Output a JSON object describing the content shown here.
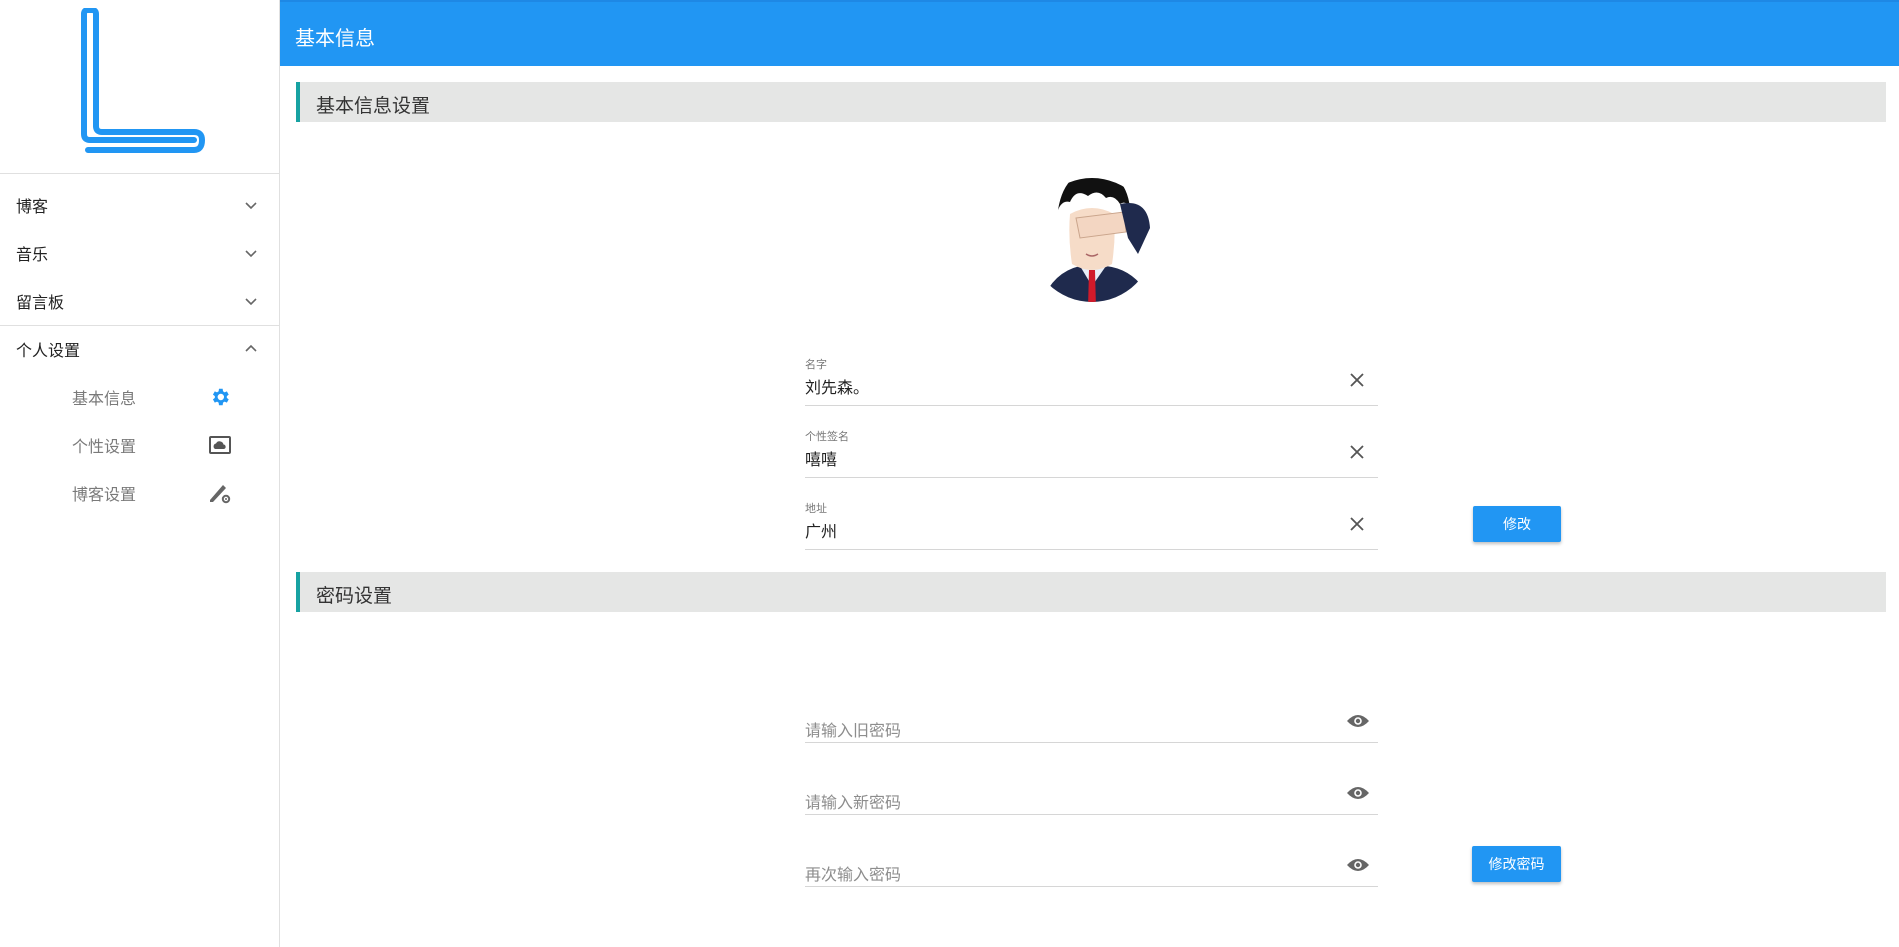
{
  "sidebar": {
    "logo_icon": "letter-l-logo",
    "groups": [
      {
        "label": "博客",
        "icon": "chevron-down-icon"
      },
      {
        "label": "音乐",
        "icon": "chevron-down-icon"
      },
      {
        "label": "留言板",
        "icon": "chevron-down-icon"
      },
      {
        "label": "个人设置",
        "icon": "chevron-up-icon"
      }
    ],
    "subitems": [
      {
        "label": "基本信息",
        "icon": "gear-icon",
        "active": true
      },
      {
        "label": "个性设置",
        "icon": "cloud-image-icon"
      },
      {
        "label": "博客设置",
        "icon": "pencil-gear-icon"
      }
    ]
  },
  "header": {
    "title": "基本信息"
  },
  "basic_section": {
    "title": "基本信息设置",
    "fields": [
      {
        "label": "名字",
        "value": "刘先森。"
      },
      {
        "label": "个性签名",
        "value": "嘻嘻"
      },
      {
        "label": "地址",
        "value": "广州"
      }
    ],
    "submit_label": "修改"
  },
  "password_section": {
    "title": "密码设置",
    "fields": [
      {
        "placeholder": "请输入旧密码"
      },
      {
        "placeholder": "请输入新密码"
      },
      {
        "placeholder": "再次输入密码"
      }
    ],
    "submit_label": "修改密码"
  },
  "colors": {
    "primary": "#2196f3",
    "accent_bar": "#17a2a2",
    "section_bg": "#e5e6e5"
  }
}
